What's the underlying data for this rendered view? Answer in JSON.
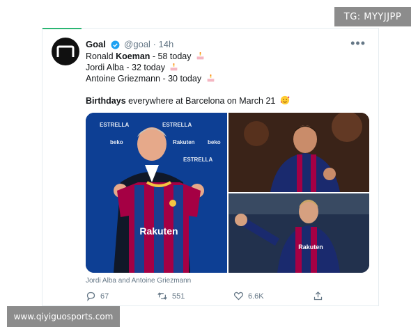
{
  "watermarks": {
    "top": "TG: MYYJJPP",
    "bottom": "www.qiyiguosports.com"
  },
  "tweet": {
    "author_name": "Goal",
    "handle": "@goal",
    "separator": "·",
    "time": "14h",
    "lines": [
      {
        "pre": "Ronald ",
        "bold": "Koeman",
        "post": " - 58 today"
      },
      {
        "pre": "Jordi Alba - 32 today",
        "bold": "",
        "post": ""
      },
      {
        "pre": "Antoine Griezmann - 30 today",
        "bold": "",
        "post": ""
      }
    ],
    "closing": {
      "bold": "Birthdays",
      "post": " everywhere at Barcelona on March 21"
    },
    "media_caption": "Jordi Alba and Antoine Griezmann",
    "media_text": {
      "sponsor": "Rakuten",
      "brand": "beko",
      "estrella": "ESTRELLA"
    },
    "stats": {
      "replies": "67",
      "retweets": "551",
      "likes": "6.6K"
    }
  },
  "colors": {
    "accent_green": "#2bb673",
    "verified_blue": "#1da1f2",
    "barca_blue": "#0b3d91",
    "barca_red": "#a50044",
    "watermark_grey": "#8c8c8c"
  },
  "icons": [
    "goal-logo-icon",
    "verified-icon",
    "more-icon",
    "cake-icon",
    "smiling-face-with-hearts-icon",
    "reply-icon",
    "retweet-icon",
    "like-icon",
    "share-icon"
  ]
}
